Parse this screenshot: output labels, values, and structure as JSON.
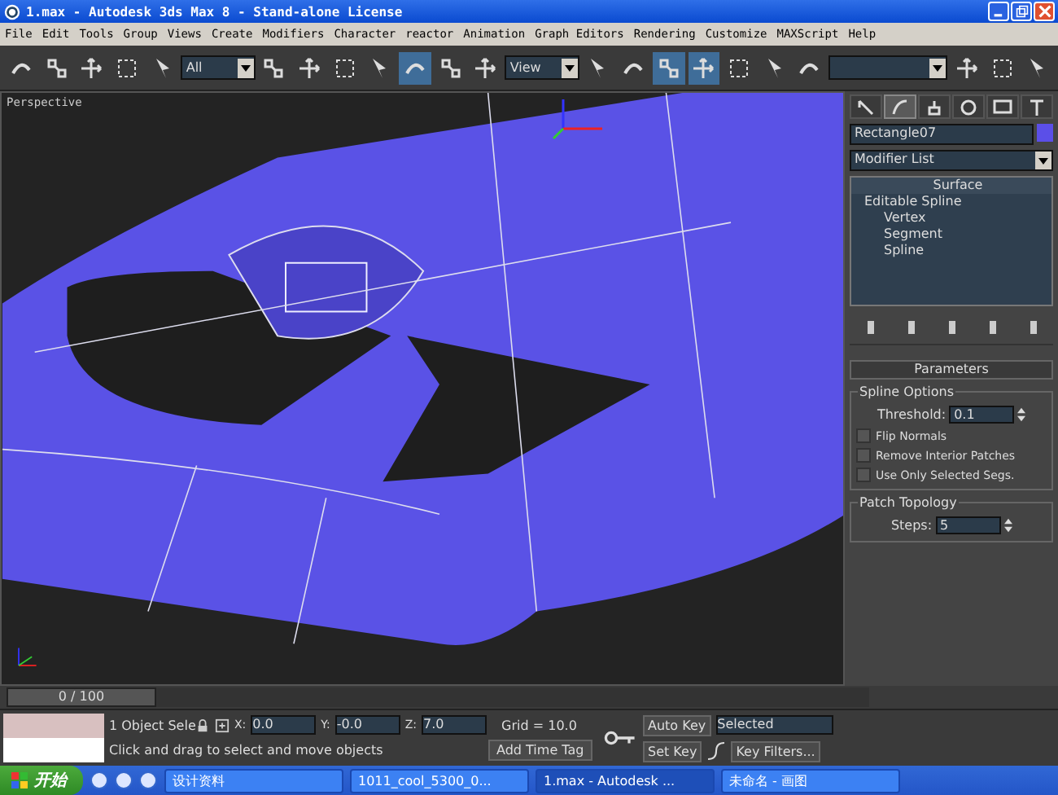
{
  "window": {
    "title": "1.max - Autodesk 3ds Max 8  - Stand-alone License"
  },
  "menu": [
    "File",
    "Edit",
    "Tools",
    "Group",
    "Views",
    "Create",
    "Modifiers",
    "Character",
    "reactor",
    "Animation",
    "Graph Editors",
    "Rendering",
    "Customize",
    "MAXScript",
    "Help"
  ],
  "toolbar": [
    {
      "kind": "button",
      "active": false
    },
    {
      "kind": "button",
      "active": false
    },
    {
      "kind": "button",
      "active": false
    },
    {
      "kind": "button",
      "active": false
    },
    {
      "kind": "button",
      "active": false
    },
    {
      "kind": "dropdown",
      "value": "All"
    },
    {
      "kind": "button",
      "active": false
    },
    {
      "kind": "button",
      "active": false
    },
    {
      "kind": "button",
      "active": false
    },
    {
      "kind": "button",
      "active": false
    },
    {
      "kind": "button",
      "active": true
    },
    {
      "kind": "button",
      "active": false
    },
    {
      "kind": "button",
      "active": false
    },
    {
      "kind": "dropdown",
      "value": "View"
    },
    {
      "kind": "button",
      "active": false
    },
    {
      "kind": "button",
      "active": false
    },
    {
      "kind": "button",
      "active": true
    },
    {
      "kind": "button",
      "active": true
    },
    {
      "kind": "button",
      "active": false
    },
    {
      "kind": "button",
      "active": false
    },
    {
      "kind": "button",
      "active": false
    },
    {
      "kind": "dropdown"
    },
    {
      "kind": "button",
      "active": false
    },
    {
      "kind": "button",
      "active": false
    },
    {
      "kind": "button",
      "active": false
    }
  ],
  "viewport": {
    "label": "Perspective"
  },
  "command_panel": {
    "tabs": [
      {
        "selected": false
      },
      {
        "selected": true
      },
      {
        "selected": false
      },
      {
        "selected": false
      },
      {
        "selected": false
      },
      {
        "selected": false
      }
    ],
    "object_name": "Rectangle07",
    "modifier_list": "Modifier List",
    "stack": [
      {
        "label": "Surface"
      },
      {
        "label": "Editable Spline",
        "children": [
          {
            "label": "Vertex"
          },
          {
            "label": "Segment"
          },
          {
            "label": "Spline"
          }
        ]
      }
    ],
    "rollout": {
      "title": "Parameters",
      "groups": [
        {
          "title": "Spline Options",
          "fields": [
            {
              "label": "Threshold:",
              "value": "0.1"
            }
          ],
          "checkboxes": [
            {
              "label": "Flip Normals",
              "checked": false
            },
            {
              "label": "Remove Interior Patches",
              "checked": false
            },
            {
              "label": "Use Only Selected Segs.",
              "checked": false
            }
          ]
        },
        {
          "title": "Patch Topology",
          "fields": [
            {
              "label": "Steps:",
              "value": "5"
            }
          ]
        }
      ]
    }
  },
  "timeline": {
    "position": "0 / 100",
    "level": 0
  },
  "status": {
    "selection": "1 Object Sele",
    "coords": [
      {
        "axis": "X:",
        "value": "0.0"
      },
      {
        "axis": "Y:",
        "value": "-0.0"
      },
      {
        "axis": "Z:",
        "value": "7.0"
      }
    ],
    "grid": "Grid = 10.0",
    "prompt": "Click and drag to select and move objects",
    "time_tag": "Add Time Tag",
    "auto_key": "Auto Key",
    "key_mode": "Selected",
    "set_key": "Set Key",
    "key_filters": "Key Filters..."
  },
  "taskbar": {
    "start": "开始",
    "items": [
      {
        "label": "设计资料",
        "selected": false
      },
      {
        "label": "1011_cool_5300_0...",
        "selected": false
      },
      {
        "label": "1.max - Autodesk ...",
        "selected": true
      },
      {
        "label": "未命名 - 画图",
        "selected": false
      }
    ]
  }
}
